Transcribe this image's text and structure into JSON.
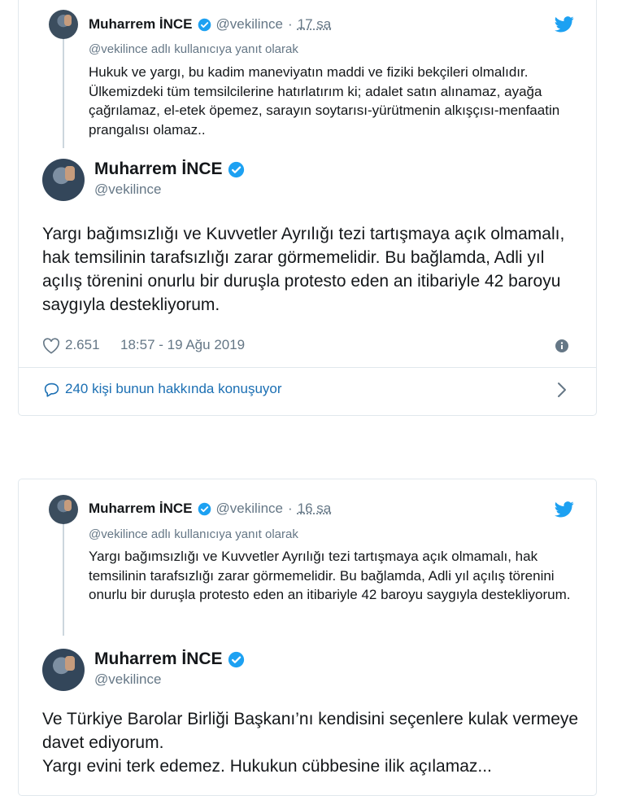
{
  "tweets": [
    {
      "parent": {
        "name": "Muharrem İNCE",
        "handle": "@vekilince",
        "separator": "·",
        "time": "17 sa",
        "reply_to": "@vekilince adlı kullanıcıya yanıt olarak",
        "text": "Hukuk ve yargı, bu kadim maneviyatın maddi ve fiziki bekçileri olmalıdır.  Ülkemizdeki tüm temsilcilerine hatırlatırım ki; adalet satın alınamaz, ayağa çağrılamaz, el-etek öpemez, sarayın soytarısı-yürütmenin alkışçısı-menfaatin prangalısı olamaz.."
      },
      "main": {
        "name": "Muharrem İNCE",
        "handle": "@vekilince",
        "text": "Yargı bağımsızlığı ve Kuvvetler Ayrılığı tezi tartışmaya açık olmamalı, hak temsilinin tarafsızlığı zarar görmemelidir. Bu bağlamda, Adli yıl açılış törenini onurlu bir duruşla protesto eden an itibariyle 42 baroyu saygıyla destekliyorum.",
        "likes": "2.651",
        "date": "18:57 - 19 Ağu 2019",
        "conversation": "240 kişi bunun hakkında konuşuyor"
      }
    },
    {
      "parent": {
        "name": "Muharrem İNCE",
        "handle": "@vekilince",
        "separator": "·",
        "time": "16 sa",
        "reply_to": "@vekilince adlı kullanıcıya yanıt olarak",
        "text": "Yargı bağımsızlığı ve Kuvvetler Ayrılığı tezi tartışmaya açık olmamalı, hak temsilinin tarafsızlığı zarar görmemelidir. Bu bağlamda, Adli yıl açılış törenini onurlu bir duruşla protesto eden an itibariyle 42 baroyu saygıyla destekliyorum."
      },
      "main": {
        "name": "Muharrem İNCE",
        "handle": "@vekilince",
        "text_line1": "Ve Türkiye Barolar Birliği Başkanı’nı kendisini seçenlere kulak vermeye davet ediyorum.",
        "text_line2": "Yargı evini terk edemez. Hukukun cübbesine ilik açılamaz..."
      }
    }
  ],
  "colors": {
    "accent": "#1da1f2",
    "link": "#1b6fb3",
    "secondary_text": "#657786",
    "border": "#e1e8ed"
  },
  "icons": [
    "verified-badge-icon",
    "twitter-bird-icon",
    "heart-icon",
    "info-icon",
    "reply-bubble-icon",
    "chevron-right-icon"
  ]
}
